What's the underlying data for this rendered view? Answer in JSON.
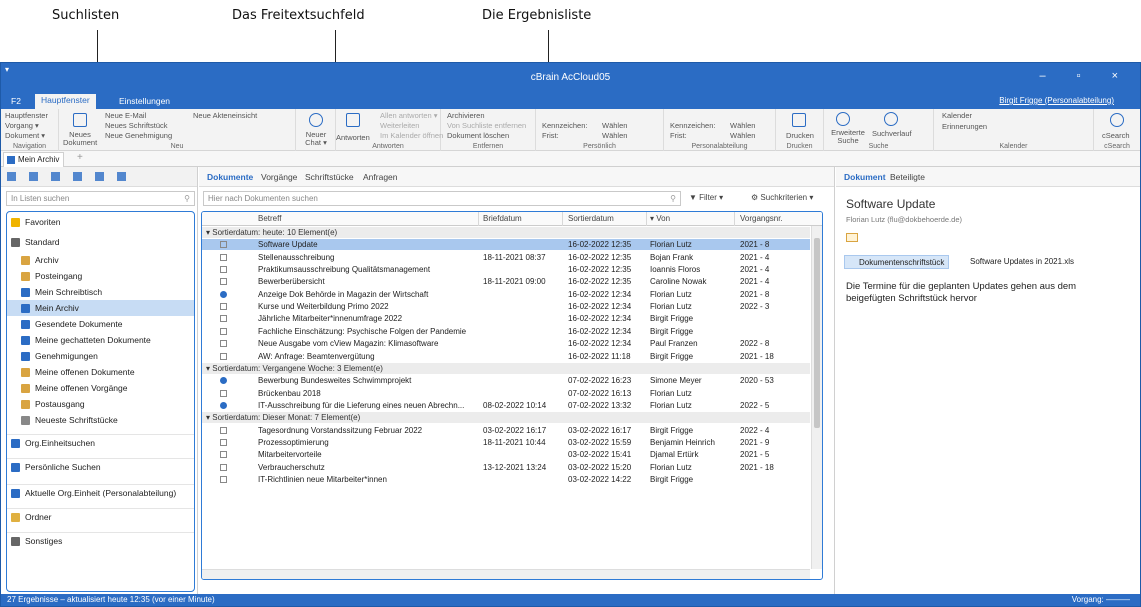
{
  "callouts": {
    "lists": "Suchlisten",
    "freetext": "Das Freitextsuchfeld",
    "results": "Die Ergebnisliste"
  },
  "window": {
    "title": "cBrain AcCloud05",
    "controls": "– ▫ ×"
  },
  "ribbon_tabs": [
    "F2",
    "Hauptfenster",
    "Einstellungen"
  ],
  "user": "Birgit Frigge (Personalabteilung)",
  "ribbon": {
    "navigation": {
      "items": [
        "Hauptfenster",
        "Vorgang ▾",
        "Dokument ▾"
      ],
      "label": "Navigation"
    },
    "neu": {
      "big": "Neues Dokument",
      "items": [
        "Neue E-Mail",
        "Neues Schriftstück",
        "Neue Genehmigung",
        "Neue Akteneinsicht"
      ],
      "label": "Neu"
    },
    "chat": "Neuer Chat ▾",
    "antworten": {
      "big": "Antworten",
      "items": [
        "Allen antworten ▾",
        "Weiterleiten",
        "Im Kalender öffnen"
      ],
      "label": "Antworten"
    },
    "entfernen": {
      "items": [
        "Archivieren",
        "Von Suchliste entfernen",
        "Dokument löschen"
      ],
      "label": "Entfernen"
    },
    "persoenlich": {
      "kennzeichen": "Kennzeichen:",
      "frist": "Frist:",
      "waehlen": "Wählen",
      "label": "Persönlich"
    },
    "personalabteilung": {
      "kennzeichen": "Kennzeichen:",
      "frist": "Frist:",
      "waehlen": "Wählen",
      "label": "Personalabteilung"
    },
    "drucken": {
      "big": "Drucken",
      "label": "Drucken"
    },
    "suche": {
      "items": [
        "Erweiterte Suche",
        "Suchverlauf"
      ],
      "label": "Suche"
    },
    "kalender": {
      "items": [
        "Kalender",
        "Erinnerungen"
      ],
      "label": "Kalender"
    },
    "csearch": {
      "big": "cSearch",
      "label": "cSearch"
    }
  },
  "doc_tab": "Mein Archiv",
  "left": {
    "search_placeholder": "In Listen suchen",
    "items": [
      {
        "label": "Favoriten",
        "kind": "group",
        "color": "#f0b400"
      },
      {
        "label": "Standard",
        "kind": "group",
        "color": "#666666"
      },
      {
        "label": "Archiv",
        "kind": "item",
        "color": "#d9a441"
      },
      {
        "label": "Posteingang",
        "kind": "item",
        "color": "#d9a441"
      },
      {
        "label": "Mein Schreibtisch",
        "kind": "item",
        "color": "#2b6cc4"
      },
      {
        "label": "Mein Archiv",
        "kind": "item",
        "color": "#2b6cc4",
        "selected": true
      },
      {
        "label": "Gesendete Dokumente",
        "kind": "item",
        "color": "#2b6cc4"
      },
      {
        "label": "Meine gechatteten Dokumente",
        "kind": "item",
        "color": "#2b6cc4"
      },
      {
        "label": "Genehmigungen",
        "kind": "item",
        "color": "#2b6cc4"
      },
      {
        "label": "Meine offenen Dokumente",
        "kind": "item",
        "color": "#d9a441"
      },
      {
        "label": "Meine offenen Vorgänge",
        "kind": "item",
        "color": "#d9a441"
      },
      {
        "label": "Postausgang",
        "kind": "item",
        "color": "#d9a441"
      },
      {
        "label": "Neueste Schriftstücke",
        "kind": "item",
        "color": "#888888"
      },
      {
        "label": "Org.Einheitsuchen",
        "kind": "group",
        "color": "#2b6cc4"
      },
      {
        "label": "Persönliche Suchen",
        "kind": "group",
        "color": "#2b6cc4"
      },
      {
        "label": "Aktuelle Org.Einheit (Personalabteilung)",
        "kind": "group",
        "color": "#2b6cc4"
      },
      {
        "label": "Ordner",
        "kind": "group",
        "color": "#e0b040"
      },
      {
        "label": "Sonstiges",
        "kind": "group",
        "color": "#666666"
      }
    ]
  },
  "center": {
    "tabs": [
      "Dokumente",
      "Vorgänge",
      "Schriftstücke",
      "Anfragen"
    ],
    "search_placeholder": "Hier nach Dokumenten suchen",
    "filter": "Filter ▾",
    "criteria": "Suchkriterien ▾",
    "columns": [
      "Betreff",
      "Briefdatum",
      "Sortierdatum",
      "▾ Von",
      "Vorgangsnr."
    ],
    "rows": [
      {
        "type": "group",
        "text": "▾ Sortierdatum: heute: 10 Element(e)"
      },
      {
        "type": "row",
        "betreff": "Software Update",
        "brief": "",
        "sort": "16-02-2022 12:35",
        "von": "Florian Lutz",
        "nr": "2021 - 8",
        "sel": true
      },
      {
        "type": "row",
        "betreff": "Stellenausschreibung",
        "brief": "18-11-2021 08:37",
        "sort": "16-02-2022 12:35",
        "von": "Bojan Frank",
        "nr": "2021 - 4"
      },
      {
        "type": "row",
        "betreff": "Praktikumsausschreibung Qualitätsmanagement",
        "brief": "",
        "sort": "16-02-2022 12:35",
        "von": "Ioannis Floros",
        "nr": "2021 - 4"
      },
      {
        "type": "row",
        "betreff": "Bewerberübersicht",
        "brief": "18-11-2021 09:00",
        "sort": "16-02-2022 12:35",
        "von": "Caroline Nowak",
        "nr": "2021 - 4"
      },
      {
        "type": "row",
        "betreff": "Anzeige Dok Behörde in Magazin der Wirtschaft",
        "brief": "",
        "sort": "16-02-2022 12:34",
        "von": "Florian Lutz",
        "nr": "2021 - 8",
        "blue": true
      },
      {
        "type": "row",
        "betreff": "Kurse und Weiterbildung Primo 2022",
        "brief": "",
        "sort": "16-02-2022 12:34",
        "von": "Florian Lutz",
        "nr": "2022 - 3"
      },
      {
        "type": "row",
        "betreff": "Jährliche Mitarbeiter*innenumfrage 2022",
        "brief": "",
        "sort": "16-02-2022 12:34",
        "von": "Birgit Frigge",
        "nr": ""
      },
      {
        "type": "row",
        "betreff": "Fachliche Einschätzung: Psychische Folgen der Pandemie",
        "brief": "",
        "sort": "16-02-2022 12:34",
        "von": "Birgit Frigge",
        "nr": ""
      },
      {
        "type": "row",
        "betreff": "Neue Ausgabe vom cView Magazin: Klimasoftware",
        "brief": "",
        "sort": "16-02-2022 12:34",
        "von": "Paul Franzen",
        "nr": "2022 - 8"
      },
      {
        "type": "row",
        "betreff": "AW: Anfrage: Beamtenvergütung",
        "brief": "",
        "sort": "16-02-2022 11:18",
        "von": "Birgit Frigge",
        "nr": "2021 - 18"
      },
      {
        "type": "group",
        "text": "▾ Sortierdatum: Vergangene Woche: 3 Element(e)"
      },
      {
        "type": "row",
        "betreff": "Bewerbung Bundesweites Schwimmprojekt",
        "brief": "",
        "sort": "07-02-2022 16:23",
        "von": "Simone Meyer",
        "nr": "2020 - 53",
        "blue": true
      },
      {
        "type": "row",
        "betreff": "Brückenbau 2018",
        "brief": "",
        "sort": "07-02-2022 16:13",
        "von": "Florian Lutz",
        "nr": ""
      },
      {
        "type": "row",
        "betreff": "IT-Ausschreibung für die Lieferung eines neuen Abrechn...",
        "brief": "08-02-2022 10:14",
        "sort": "07-02-2022 13:32",
        "von": "Florian Lutz",
        "nr": "2022 - 5",
        "blue": true
      },
      {
        "type": "group",
        "text": "▾ Sortierdatum: Dieser Monat: 7 Element(e)"
      },
      {
        "type": "row",
        "betreff": "Tagesordnung Vorstandssitzung Februar 2022",
        "brief": "03-02-2022 16:17",
        "sort": "03-02-2022 16:17",
        "von": "Birgit Frigge",
        "nr": "2022 - 4"
      },
      {
        "type": "row",
        "betreff": "Prozessoptimierung",
        "brief": "18-11-2021 10:44",
        "sort": "03-02-2022 15:59",
        "von": "Benjamin Heinrich",
        "nr": "2021 - 9"
      },
      {
        "type": "row",
        "betreff": "Mitarbeitervorteile",
        "brief": "",
        "sort": "03-02-2022 15:41",
        "von": "Djamal Ertürk",
        "nr": "2021 - 5"
      },
      {
        "type": "row",
        "betreff": "Verbraucherschutz",
        "brief": "13-12-2021 13:24",
        "sort": "03-02-2022 15:20",
        "von": "Florian Lutz",
        "nr": "2021 - 18"
      },
      {
        "type": "row",
        "betreff": "IT-Richtlinien neue Mitarbeiter*innen",
        "brief": "",
        "sort": "03-02-2022 14:22",
        "von": "Birgit Frigge",
        "nr": ""
      }
    ]
  },
  "right": {
    "tabs": [
      "Dokument",
      "Beteiligte"
    ],
    "title": "Software Update",
    "from": "Florian Lutz (flu@dokbehoerde.de)",
    "attachments": [
      "Dokumentenschriftstück",
      "Software Updates in 2021.xls"
    ],
    "body": "Die Termine für die geplanten Updates gehen aus dem beigefügten Schriftstück hervor"
  },
  "status": {
    "left": "27 Ergebnisse – aktualisiert heute 12:35 (vor einer Minute)",
    "right": "Vorgang: ———"
  }
}
